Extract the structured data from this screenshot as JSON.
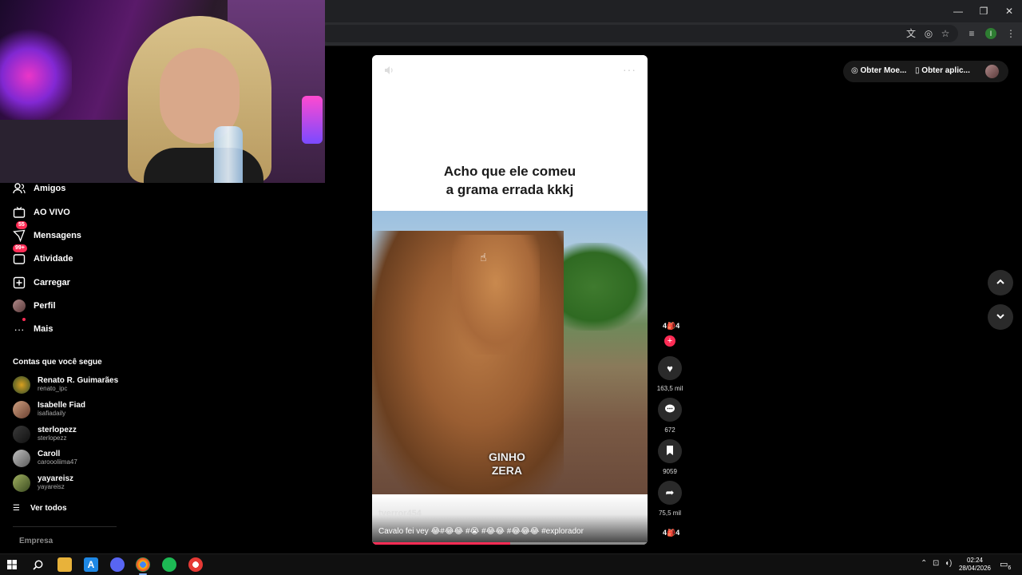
{
  "window": {
    "minimize": "—",
    "restore": "❐",
    "close": "✕"
  },
  "toolbar_icons": [
    "translate-icon",
    "eye-off-icon",
    "star-icon",
    "media-queue-icon",
    "profile-icon",
    "menu-icon"
  ],
  "profile_letter": "I",
  "sidebar": {
    "items": [
      {
        "label": "Amigos",
        "icon": "friends-icon"
      },
      {
        "label": "AO VIVO",
        "icon": "live-icon"
      },
      {
        "label": "Mensagens",
        "icon": "messages-icon",
        "badge": "55"
      },
      {
        "label": "Atividade",
        "icon": "activity-icon",
        "badge": "99+"
      },
      {
        "label": "Carregar",
        "icon": "upload-icon"
      },
      {
        "label": "Perfil",
        "icon": "profile-avatar"
      },
      {
        "label": "Mais",
        "icon": "more-icon"
      }
    ],
    "following_title": "Contas que você segue",
    "following": [
      {
        "name": "Renato R. Guimarães",
        "handle": "renato_ipc"
      },
      {
        "name": "Isabelle Fiad",
        "handle": "isafiadaily"
      },
      {
        "name": "sterlopezz",
        "handle": "sterlopezz"
      },
      {
        "name": "Caroll",
        "handle": "caroooliima47"
      },
      {
        "name": "yayareisz",
        "handle": "yayareisz"
      }
    ],
    "see_all": "Ver todos",
    "company": "Empresa"
  },
  "video": {
    "caption_line1": "Acho que ele comeu",
    "caption_line2": "a grama errada kkkj",
    "watermark_line1": "GINHO",
    "watermark_line2": "ZERA",
    "author": "tverror454",
    "description": "Cavalo fei vey 😂#😂😂 #😭 #😂😂 #😂😂😂 #explorador",
    "more": "···",
    "progress": 0.5
  },
  "rail": {
    "avatar_label": "4🎒4",
    "likes": "163,5 mil",
    "comments": "672",
    "saves": "9059",
    "shares": "75,5 mil",
    "music_label": "4🎒4"
  },
  "top_actions": {
    "coins": "Obter Moe...",
    "app": "Obter aplic..."
  },
  "taskbar": {
    "time": "02:24",
    "date": "28/04/2026",
    "notifications": "6"
  }
}
